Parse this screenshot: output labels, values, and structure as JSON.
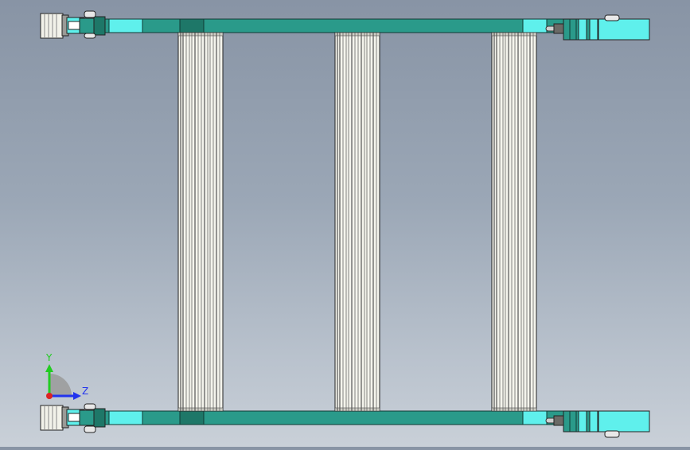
{
  "viewport": {
    "background_top": "#8894a5",
    "background_bottom": "#c9d0d8"
  },
  "colors": {
    "rail": "#2a9a8a",
    "rail_light": "#5ff0ec",
    "rail_dark": "#1e7768",
    "roller": "#f4f4ec",
    "roller_edge": "#555555"
  },
  "triad": {
    "y_label": "Y",
    "z_label": "Z",
    "y_color": "#22cc22",
    "z_color": "#2233ee",
    "x_color": "#dd2222"
  }
}
